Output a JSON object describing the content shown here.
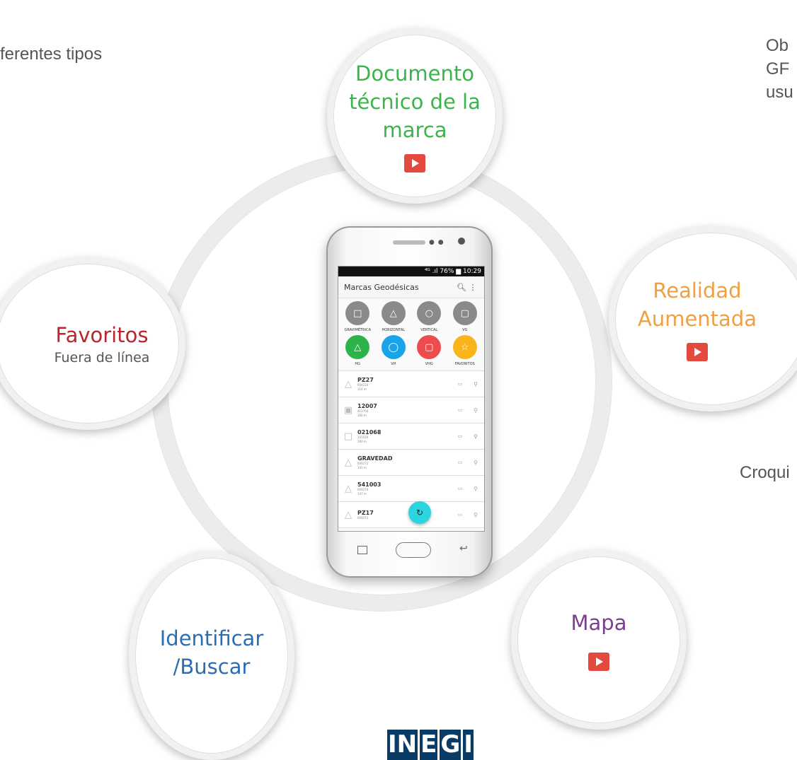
{
  "side_texts": {
    "top_left": "ferentes tipos",
    "top_right": "Ob\nGF\nusu",
    "mid_right": "Croqui"
  },
  "bubbles": {
    "documento": {
      "title": "Documento técnico de la marca",
      "color": "#3ab54a"
    },
    "realidad": {
      "title": "Realidad Aumentada",
      "color": "#f0a040"
    },
    "favoritos": {
      "title": "Favoritos",
      "subtitle": "Fuera de línea",
      "color": "#b8262e"
    },
    "identificar": {
      "title": "Identificar /Buscar",
      "color": "#2b6db3"
    },
    "mapa": {
      "title": "Mapa",
      "color": "#7b3f8f"
    }
  },
  "phone": {
    "status": "⁴ᴳ .ıl 76% ▆ 10:29",
    "app_title": "Marcas Geodésicas",
    "categories": [
      {
        "label": "GRAVIMÉTRICA",
        "color": "#8a8a8a",
        "glyph": "□"
      },
      {
        "label": "HORIZONTAL",
        "color": "#8a8a8a",
        "glyph": "△"
      },
      {
        "label": "VERTICAL",
        "color": "#8a8a8a",
        "glyph": "○"
      },
      {
        "label": "VG",
        "color": "#8a8a8a",
        "glyph": "▢"
      },
      {
        "label": "HG",
        "color": "#2cb34a",
        "glyph": "△"
      },
      {
        "label": "VH",
        "color": "#19a3e8",
        "glyph": "◯"
      },
      {
        "label": "VHG",
        "color": "#ec4c4c",
        "glyph": "▢"
      },
      {
        "label": "FAVORITOS",
        "color": "#f9b41b",
        "glyph": "☆"
      }
    ],
    "list": [
      {
        "name": "PZ27",
        "line1": "604210",
        "line2": "114 m",
        "symbol": "△"
      },
      {
        "name": "12007",
        "line1": "412700",
        "line2": "180 m",
        "symbol": "▣"
      },
      {
        "name": "021068",
        "line1": "101030",
        "line2": "190 m",
        "symbol": "□"
      },
      {
        "name": "GRAVEDAD",
        "line1": "606272",
        "line2": "141 m",
        "symbol": "△"
      },
      {
        "name": "541003",
        "line1": "604270",
        "line2": "147 m",
        "symbol": "△"
      },
      {
        "name": "PZ17",
        "line1": "604272",
        "line2": "",
        "symbol": "△"
      }
    ]
  },
  "logo": [
    "IN",
    "E",
    "G",
    "I"
  ]
}
